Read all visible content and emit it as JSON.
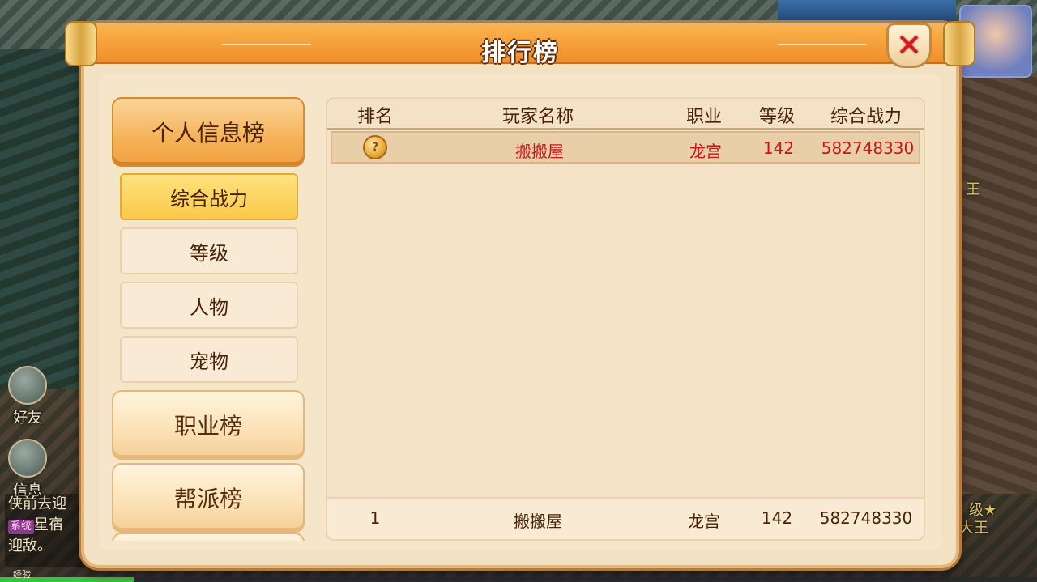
{
  "window": {
    "title": "排行榜"
  },
  "menu": {
    "categories": [
      {
        "label": "个人信息榜",
        "active": true
      },
      {
        "label": "职业榜",
        "active": false
      },
      {
        "label": "帮派榜",
        "active": false
      }
    ],
    "subitems": [
      {
        "label": "综合战力",
        "active": true
      },
      {
        "label": "等级",
        "active": false
      },
      {
        "label": "人物",
        "active": false
      },
      {
        "label": "宠物",
        "active": false
      }
    ]
  },
  "table": {
    "headers": {
      "rank": "排名",
      "name": "玩家名称",
      "job": "职业",
      "level": "等级",
      "power": "综合战力"
    },
    "rows": [
      {
        "rank_icon": "gold-medal-icon",
        "name": "搬搬屋",
        "job": "龙宫",
        "level": "142",
        "power": "582748330"
      }
    ],
    "my_rank": {
      "rank": "1",
      "name": "搬搬屋",
      "job": "龙宫",
      "level": "142",
      "power": "582748330"
    }
  },
  "hud": {
    "friends_label": "好友",
    "messages_label": "信息",
    "chat_lines": [
      "侠前去迎",
      "星宿",
      "迎敌。"
    ],
    "chat_tag": "系统",
    "exp_label": "经验",
    "exp_progress": 0.13,
    "right_text_1": "王",
    "right_text_2": "级★",
    "right_text_3": "大王"
  },
  "colors": {
    "title_bar": "#f08f2a",
    "panel_bg": "#f3e1c4",
    "highlight_text": "#c8141a",
    "close_x": "#d8161a"
  }
}
